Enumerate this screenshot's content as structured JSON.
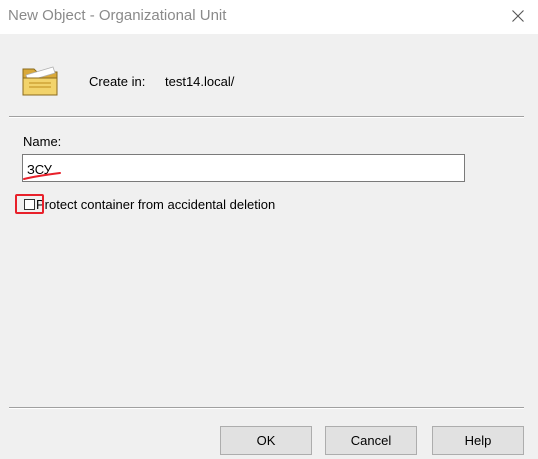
{
  "window": {
    "title": "New Object - Organizational Unit"
  },
  "header": {
    "icon": "folder-icon",
    "create_in_label": "Create in:",
    "create_in_value": "test14.local/"
  },
  "form": {
    "name_label": "Name:",
    "name_value": "ЗСУ",
    "protect_label": "Protect container from accidental deletion",
    "protect_checked": false
  },
  "buttons": {
    "ok": "OK",
    "cancel": "Cancel",
    "help": "Help"
  },
  "colors": {
    "annotation_red": "#e8202a",
    "folder_yellow": "#f2d36b"
  }
}
